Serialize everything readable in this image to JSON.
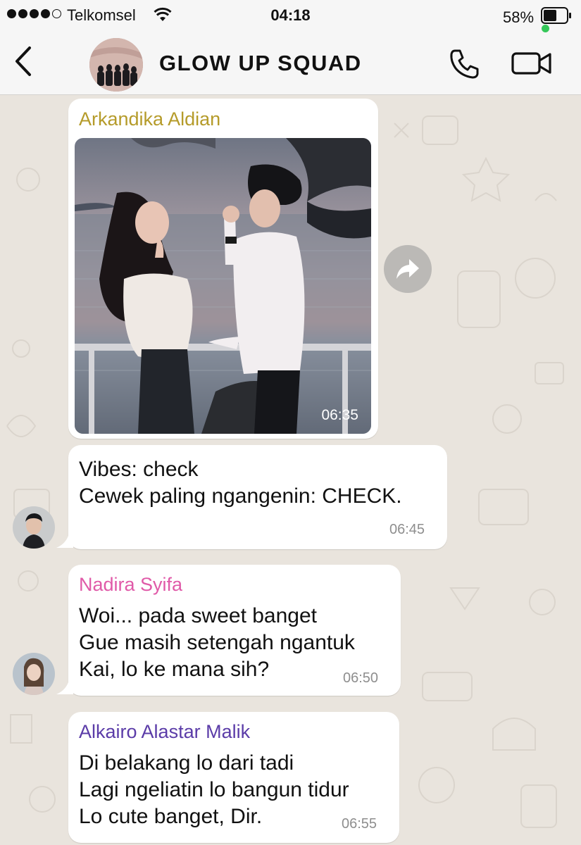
{
  "status_bar": {
    "carrier": "Telkomsel",
    "time": "04:18",
    "battery_percent": "58%"
  },
  "header": {
    "title": "GLOW UP SQUAD",
    "icons": [
      "back-chevron-icon",
      "phone-icon",
      "video-camera-icon"
    ]
  },
  "messages": [
    {
      "sender": "Arkandika Aldian",
      "sender_color": "#b59b2a",
      "type": "image",
      "time": "06:35"
    },
    {
      "sender": "",
      "lines": [
        "Vibes: check",
        "Cewek paling ngangenin: CHECK."
      ],
      "time": "06:45"
    },
    {
      "sender": "Nadira Syifa",
      "sender_color": "#e05aa8",
      "lines": [
        "Woi... pada sweet banget",
        "Gue masih setengah ngantuk",
        "Kai, lo ke mana sih?"
      ],
      "time": "06:50"
    },
    {
      "sender": "Alkairo Alastar Malik",
      "sender_color": "#5b3ca8",
      "lines": [
        "Di belakang lo dari tadi",
        "Lagi ngeliatin lo bangun tidur",
        "Lo cute banget, Dir."
      ],
      "time": "06:55"
    }
  ]
}
